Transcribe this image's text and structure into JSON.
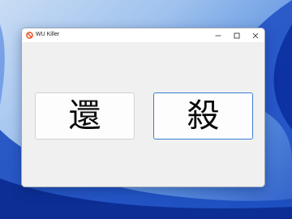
{
  "window": {
    "title": "WU Killer"
  },
  "buttons": {
    "left_label": "還",
    "right_label": "殺"
  },
  "icons": {
    "app": "prohibited-icon",
    "minimize": "minimize-icon",
    "maximize": "maximize-icon",
    "close": "close-icon"
  },
  "colors": {
    "focus_border": "#3a7dd4",
    "app_icon": "#e8501e"
  }
}
